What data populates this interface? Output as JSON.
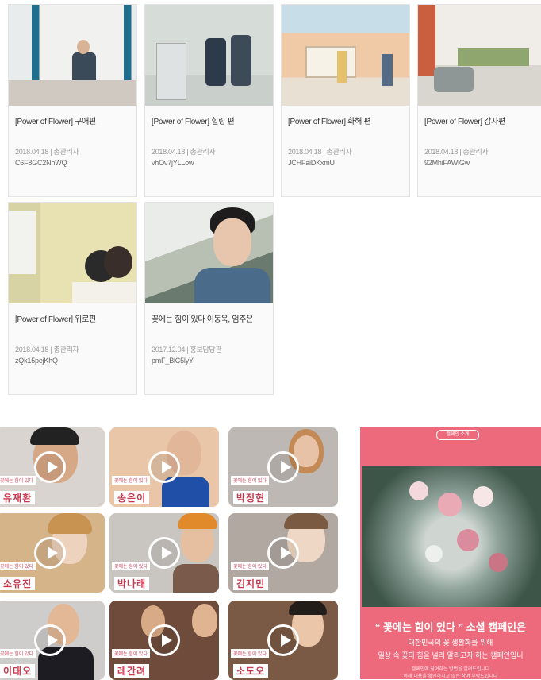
{
  "cards": [
    {
      "title": "[Power of Flower] 구애편",
      "meta": "2018.04.18 | 총관리자",
      "code": "C6F8GC2NhWQ"
    },
    {
      "title": "[Power of Flower] 힐링 편",
      "meta": "2018.04.18 | 총관리자",
      "code": "vhOv7jYLLow"
    },
    {
      "title": "[Power of Flower] 화해 편",
      "meta": "2018.04.18 | 총관리자",
      "code": "JCHFaiDKxmU"
    },
    {
      "title": "[Power of Flower] 감사편",
      "meta": "2018.04.18 | 총관리자",
      "code": "92MhiFAWlGw"
    },
    {
      "title": "[Power of Flower] 위로편",
      "meta": "2018.04.18 | 총관리자",
      "code": "zQk15pejKhQ"
    },
    {
      "title": "꽃에는 힘이 있다 이동욱, 엄주은",
      "meta": "2017.12.04 | 홍보담당관",
      "code": "pmF_BlC5lyY"
    }
  ],
  "videos": [
    {
      "tag": "꽃에는 힘이 있다",
      "name": "유재환"
    },
    {
      "tag": "꽃에는 힘이 있다",
      "name": "송은이"
    },
    {
      "tag": "꽃에는 힘이 있다",
      "name": "박정현"
    },
    {
      "tag": "꽃에는 힘이 있다",
      "name": "소유진"
    },
    {
      "tag": "꽃에는 힘이 있다",
      "name": "박나래"
    },
    {
      "tag": "꽃에는 힘이 있다",
      "name": "김지민"
    },
    {
      "tag": "꽃에는 힘이 있다",
      "name": "이태오"
    },
    {
      "tag": "꽃에는 힘이 있다",
      "name": "레간려"
    },
    {
      "tag": "꽃에는 힘이 있다",
      "name": "소도오"
    }
  ],
  "banner": {
    "pill": "캠페인 소개",
    "headline": "“ 꽃에는 힘이 있다 ” 소셜 캠페인은",
    "line1": "대한민국의 꽃 생활화를 위해",
    "line2": "일상 속 꽃의 힘을 널리 알리고자 하는 캠페인입니",
    "small1": "캠페인에 참여하는 방법을 알려드립니다",
    "small2": "아래 내용을 확인하시고 많은 참여 부탁드립니다"
  }
}
